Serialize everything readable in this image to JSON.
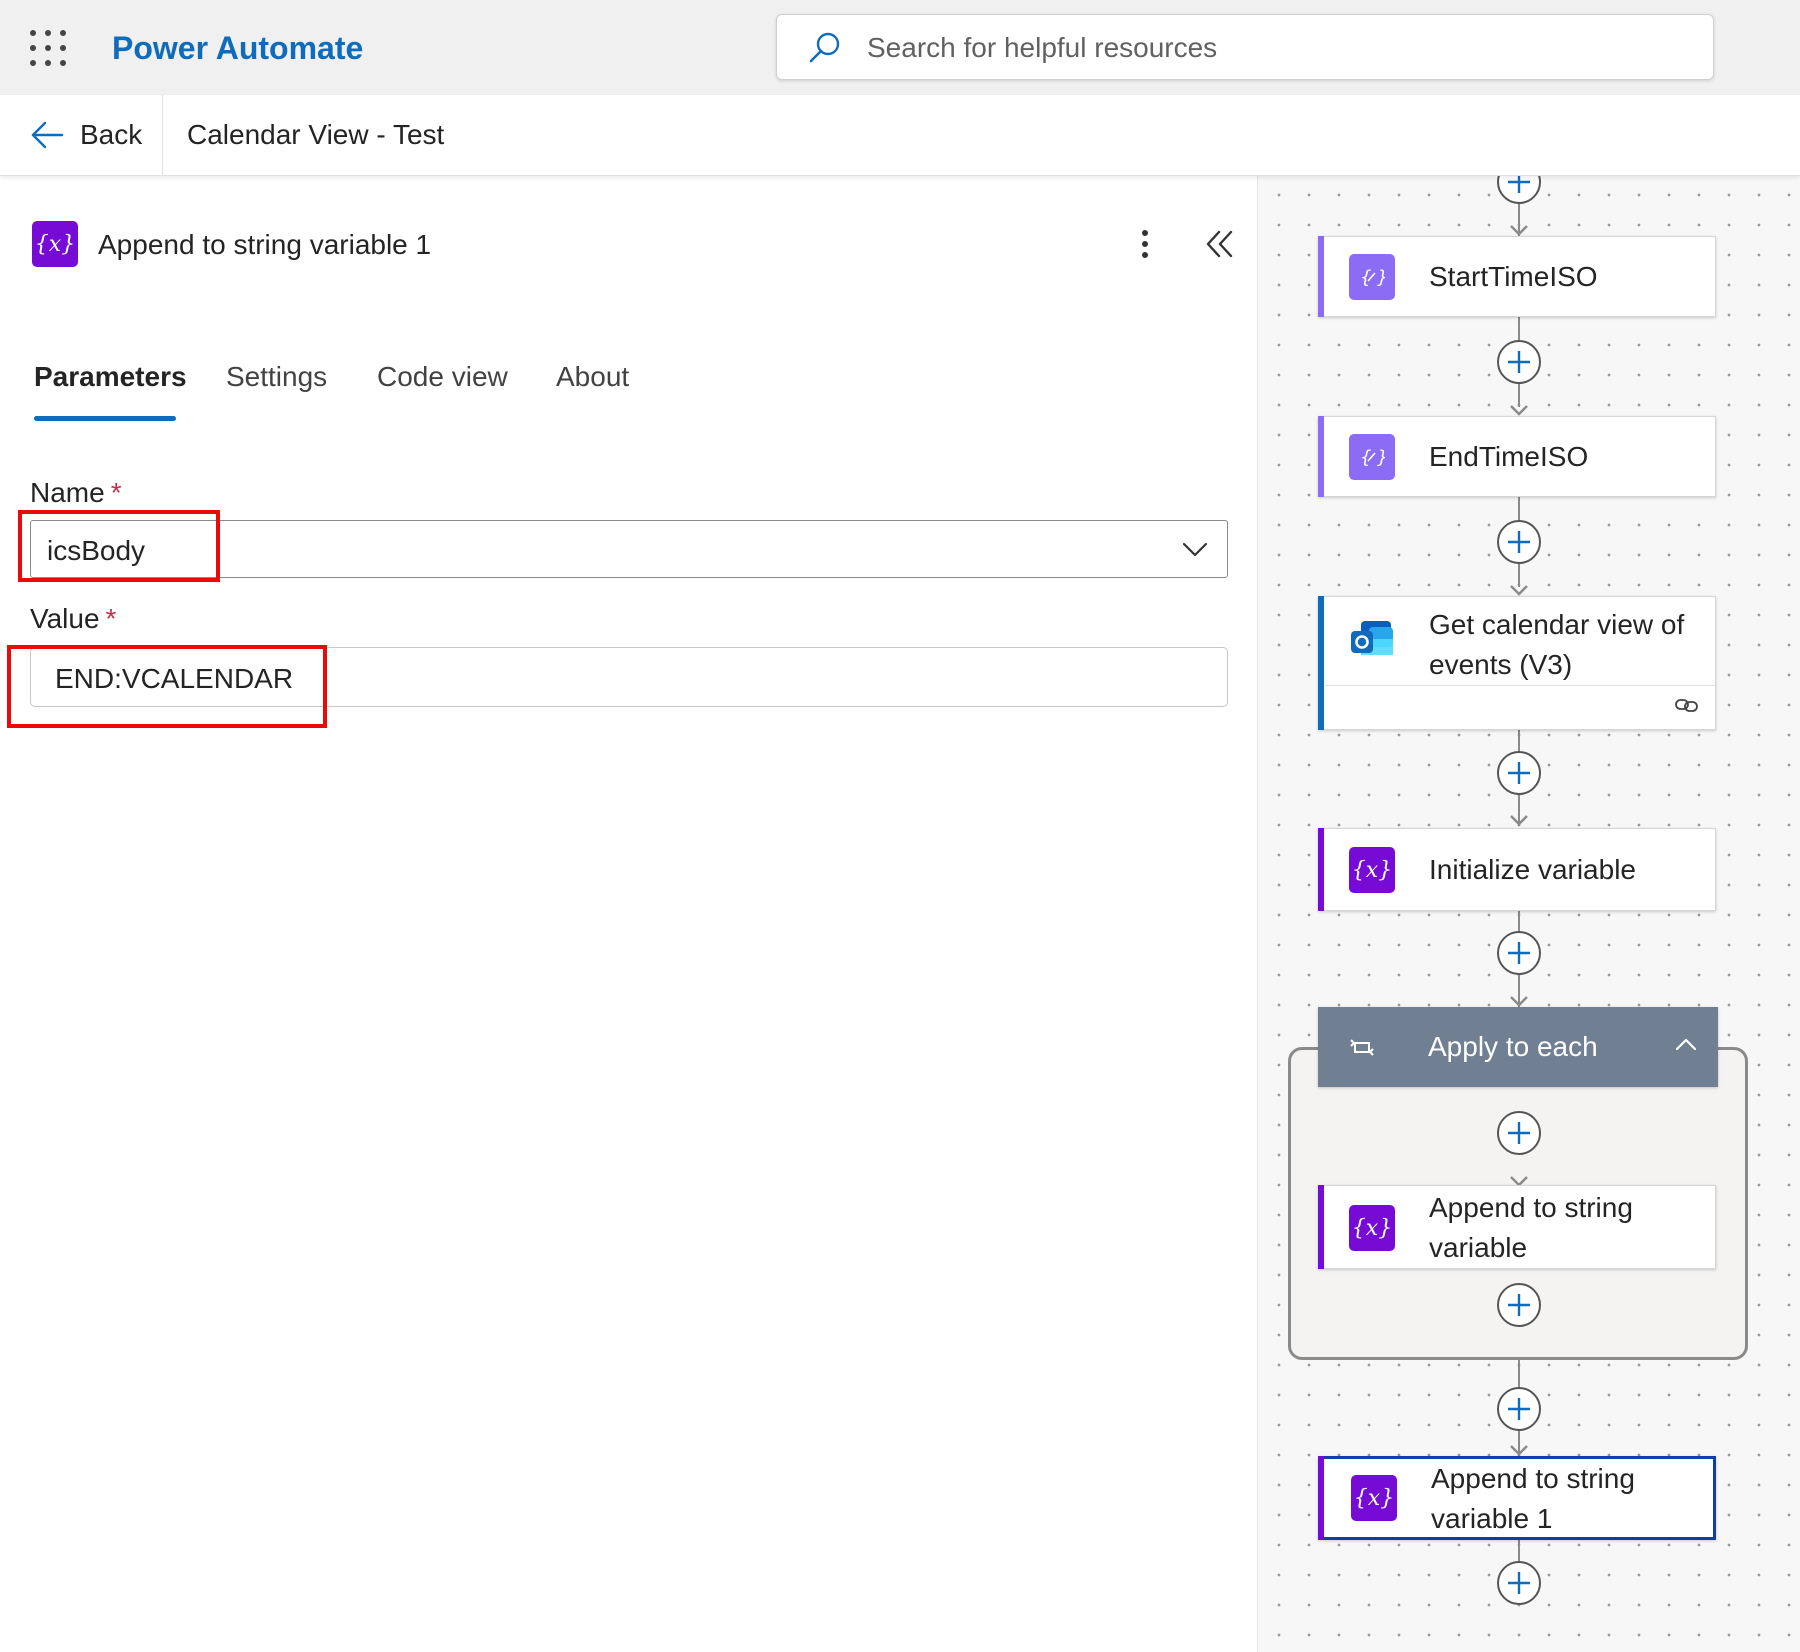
{
  "app": {
    "title": "Power Automate"
  },
  "search": {
    "placeholder": "Search for helpful resources"
  },
  "commandbar": {
    "back_label": "Back",
    "flow_name": "Calendar View - Test"
  },
  "pane": {
    "title": "Append to string variable 1",
    "icon_label": "{x}",
    "tabs": [
      {
        "label": "Parameters",
        "active": true
      },
      {
        "label": "Settings",
        "active": false
      },
      {
        "label": "Code view",
        "active": false
      },
      {
        "label": "About",
        "active": false
      }
    ],
    "fields": {
      "name": {
        "label": "Name",
        "required_mark": "*",
        "value": "icsBody"
      },
      "value": {
        "label": "Value",
        "required_mark": "*",
        "value": "END:VCALENDAR"
      }
    }
  },
  "canvas": {
    "nodes": [
      {
        "title": "StartTimeISO",
        "icon": "expression-icon",
        "color": "#8c6cf5"
      },
      {
        "title": "EndTimeISO",
        "icon": "expression-icon",
        "color": "#8c6cf5"
      },
      {
        "title": "Get calendar view of events (V3)",
        "icon": "outlook-icon",
        "color": "#0f6cbd"
      },
      {
        "title": "Initialize variable",
        "icon": "variable-icon",
        "icon_label": "{x}",
        "color": "#770bd6"
      },
      {
        "title": "Append to string variable",
        "icon": "variable-icon",
        "icon_label": "{x}",
        "color": "#770bd6"
      },
      {
        "title": "Append to string variable 1",
        "icon": "variable-icon",
        "icon_label": "{x}",
        "color": "#770bd6",
        "selected": true
      }
    ],
    "scope": {
      "title": "Apply to each",
      "color": "#707f91"
    }
  },
  "colors": {
    "brand": "#0f6cbd",
    "highlight": "#ea0a0a",
    "variable": "#770bd6",
    "selection": "#0f3ea8"
  }
}
